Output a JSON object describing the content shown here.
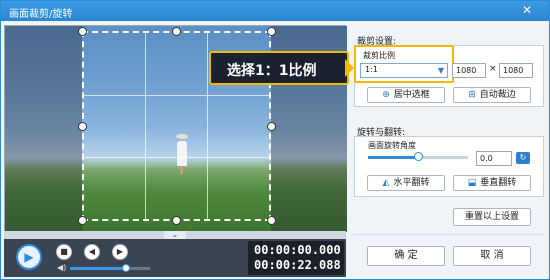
{
  "window": {
    "title": "画面裁剪/旋转",
    "close_glyph": "✕"
  },
  "preview": {
    "callout_text": "选择1：1比例"
  },
  "timeline": {
    "tab_glyph": "⌄"
  },
  "player": {
    "play_glyph": "▶",
    "stop_glyph": "■",
    "prev_glyph": "◀",
    "next_glyph": "▶",
    "volume_glyph": "◀)",
    "volume_level": 0.7,
    "current_time": "00:00:00.000",
    "total_time": "00:00:22.088"
  },
  "crop": {
    "section_title": "裁剪设置:",
    "ratio_label": "裁剪比例",
    "ratio_value": "1:1",
    "width": "1080",
    "times": "×",
    "height": "1080",
    "center_button": "居中选框",
    "auto_button": "自动裁边"
  },
  "rotate": {
    "section_title": "旋转与翻转:",
    "angle_label": "画面旋转角度",
    "angle_value": "0.0",
    "angle_fraction": 0.5,
    "hflip_button": "水平翻转",
    "vflip_button": "垂直翻转",
    "reset_button": "重置以上设置"
  },
  "footer": {
    "ok_button": "确 定",
    "cancel_button": "取 消"
  },
  "icons": {
    "center": "center-frame-icon",
    "auto": "auto-crop-icon",
    "hflip": "horizontal-flip-icon",
    "vflip": "vertical-flip-icon",
    "rotate": "rotate-icon"
  }
}
